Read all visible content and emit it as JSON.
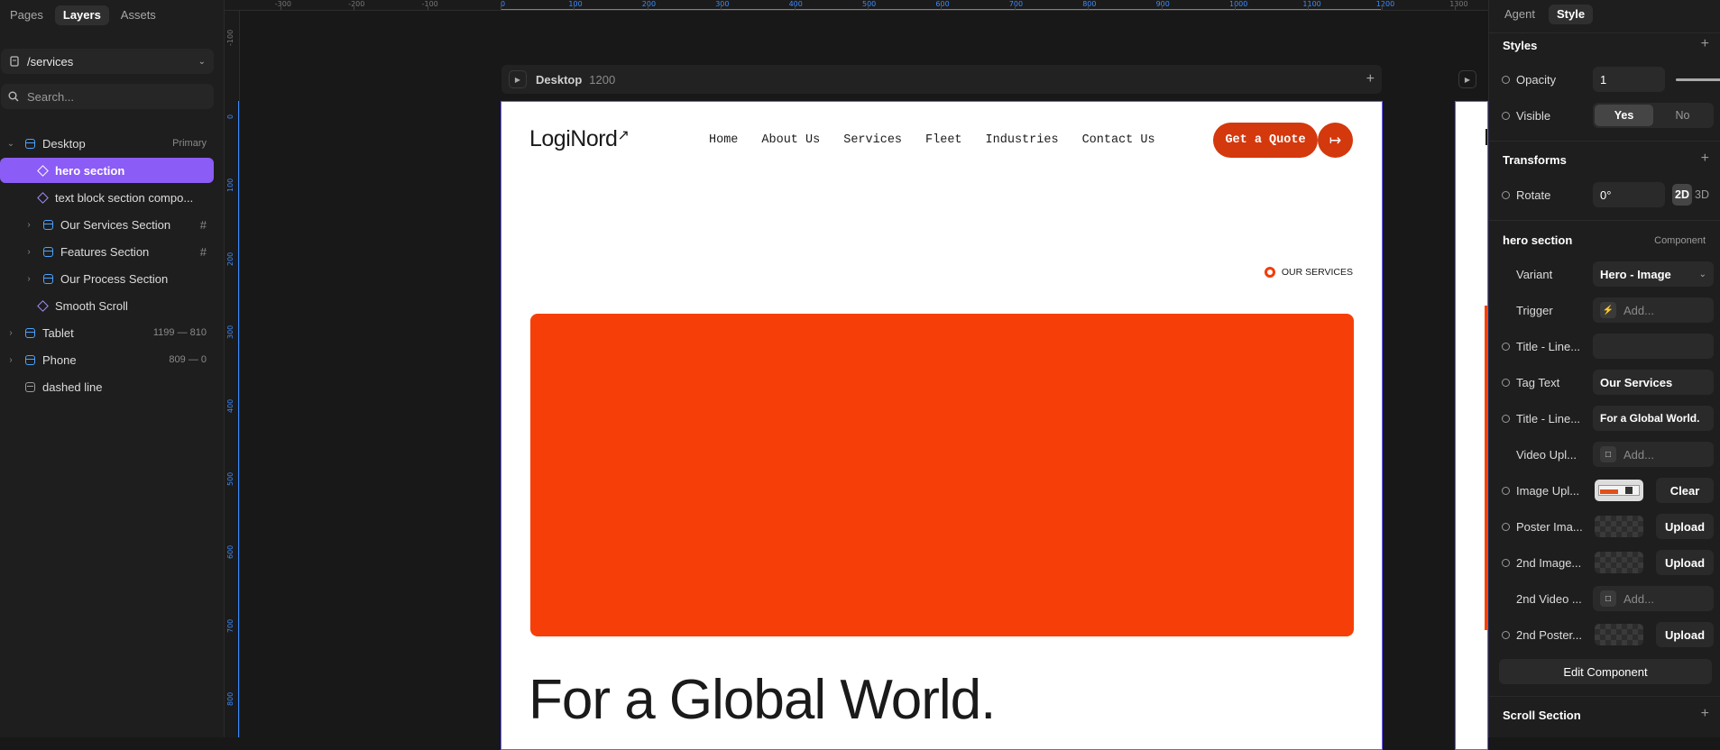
{
  "left_panel": {
    "tabs": [
      "Pages",
      "Layers",
      "Assets"
    ],
    "active_tab": "Layers",
    "page_selector": "/services",
    "search_placeholder": "Search...",
    "layers": [
      {
        "name": "Desktop",
        "meta": "Primary",
        "type": "frame",
        "expanded": true
      },
      {
        "name": "hero section",
        "meta": "",
        "type": "component",
        "selected": true
      },
      {
        "name": "text block section compo...",
        "meta": "",
        "type": "component"
      },
      {
        "name": "Our Services Section",
        "meta": "#",
        "type": "frame"
      },
      {
        "name": "Features Section",
        "meta": "#",
        "type": "frame"
      },
      {
        "name": "Our Process Section",
        "meta": "",
        "type": "frame"
      },
      {
        "name": "Smooth Scroll",
        "meta": "",
        "type": "component"
      },
      {
        "name": "Tablet",
        "meta": "1199 — 810",
        "type": "frame"
      },
      {
        "name": "Phone",
        "meta": "809 — 0",
        "type": "frame"
      },
      {
        "name": "dashed line",
        "meta": "",
        "type": "line"
      }
    ]
  },
  "rulers": {
    "horizontal": [
      "-300",
      "-200",
      "-100",
      "0",
      "100",
      "200",
      "300",
      "400",
      "500",
      "600",
      "700",
      "800",
      "900",
      "1000",
      "1100",
      "1200",
      "1300"
    ],
    "vertical": [
      "-100",
      "0",
      "100",
      "200",
      "300",
      "400",
      "500",
      "600",
      "700",
      "800"
    ]
  },
  "canvas": {
    "frame_label": "Desktop",
    "frame_width": "1200",
    "site": {
      "logo": "LogiNord",
      "nav": [
        "Home",
        "About Us",
        "Services",
        "Fleet",
        "Industries",
        "Contact Us"
      ],
      "cta": "Get a Quote",
      "cta_icon": "arrow-right-icon",
      "tag": "OUR SERVICES",
      "title": "For a Global World.",
      "hero_color": "#f63f08"
    }
  },
  "right_panel": {
    "tabs": [
      "Agent",
      "Style"
    ],
    "active_tab": "Style",
    "styles_heading": "Styles",
    "opacity_label": "Opacity",
    "opacity_value": "1",
    "opacity_level": 1.0,
    "visible_label": "Visible",
    "visible_yes": "Yes",
    "visible_no": "No",
    "transforms_heading": "Transforms",
    "rotate_label": "Rotate",
    "rotate_value": "0°",
    "mode_2d": "2D",
    "mode_3d": "3D",
    "component_name": "hero section",
    "component_badge": "Component",
    "variant_label": "Variant",
    "variant_value": "Hero - Image",
    "trigger_label": "Trigger",
    "add_placeholder": "Add...",
    "title_line_1_label": "Title - Line...",
    "title_line_1_value": "",
    "tag_text_label": "Tag Text",
    "tag_text_value": "Our Services",
    "title_line_2_label": "Title - Line...",
    "title_line_2_value": "For a Global World.",
    "video_upload_label": "Video Upl...",
    "image_upload_label": "Image Upl...",
    "clear_label": "Clear",
    "poster_image_label": "Poster Ima...",
    "second_image_label": "2nd Image...",
    "second_video_label": "2nd Video ...",
    "second_poster_label": "2nd Poster...",
    "upload_label": "Upload",
    "edit_component": "Edit Component",
    "scroll_section": "Scroll Section"
  }
}
